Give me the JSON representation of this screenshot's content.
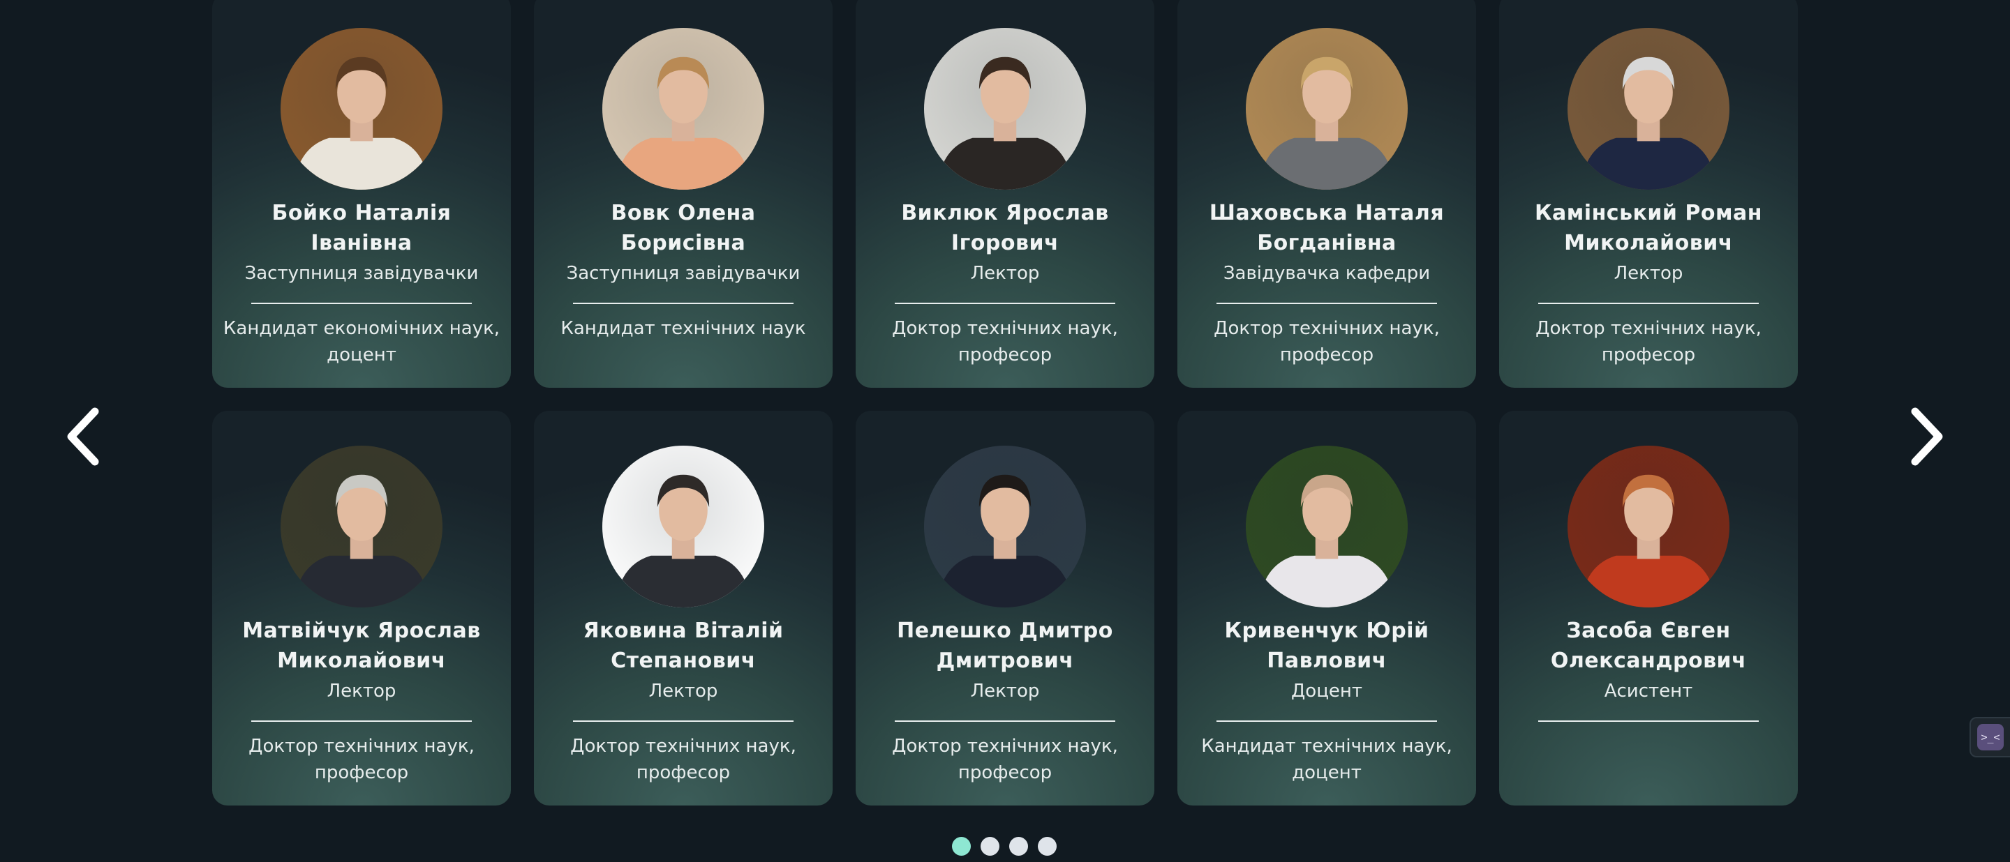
{
  "nav": {
    "prev_icon": "chevron-left-icon",
    "next_icon": "chevron-right-icon"
  },
  "staff": [
    {
      "name": "Бойко Наталія Іванівна",
      "role": "Заступниця завідувачки",
      "degree": "Кандидат економічних наук, доцент",
      "photo_colors": [
        "#8a5a2e",
        "#e9e4da",
        "#5b3b22"
      ]
    },
    {
      "name": "Вовк Олена Борисівна",
      "role": "Заступниця завідувачки",
      "degree": "Кандидат технічних наук",
      "photo_colors": [
        "#d9c9b4",
        "#e8a67f",
        "#b98a55"
      ]
    },
    {
      "name": "Виклюк Ярослав Ігорович",
      "role": "Лектор",
      "degree": "Доктор технічних наук, професор",
      "photo_colors": [
        "#d8d8d4",
        "#2a2624",
        "#3a2a20"
      ]
    },
    {
      "name": "Шаховська Наталя Богданівна",
      "role": "Завідувачка кафедри",
      "degree": "Доктор технічних наук, професор",
      "photo_colors": [
        "#b28a55",
        "#6b6e72",
        "#c9a56a"
      ]
    },
    {
      "name": "Камінський Роман Миколайович",
      "role": "Лектор",
      "degree": "Доктор технічних наук, професор",
      "photo_colors": [
        "#7a5a3a",
        "#1e2742",
        "#d8d8d8"
      ]
    },
    {
      "name": "Матвійчук Ярослав Миколайович",
      "role": "Лектор",
      "degree": "Доктор технічних наук, професор",
      "photo_colors": [
        "#3a3a2a",
        "#262a33",
        "#c9c9c4"
      ]
    },
    {
      "name": "Яковина Віталій Степанович",
      "role": "Лектор",
      "degree": "Доктор технічних наук, професор",
      "photo_colors": [
        "#ffffff",
        "#2a2d33",
        "#2e2a28"
      ]
    },
    {
      "name": "Пелешко Дмитро Дмитрович",
      "role": "Лектор",
      "degree": "Доктор технічних наук, професор",
      "photo_colors": [
        "#2d3a46",
        "#1c2230",
        "#1e1a18"
      ]
    },
    {
      "name": "Кривенчук Юрій Павлович",
      "role": "Доцент",
      "degree": "Кандидат технічних наук, доцент",
      "photo_colors": [
        "#2e4a22",
        "#e8e6ea",
        "#c9a68a"
      ]
    },
    {
      "name": "Засоба Євген Олександрович",
      "role": "Асистент",
      "degree": "",
      "photo_colors": [
        "#7a2a18",
        "#c03a1e",
        "#c2703e"
      ]
    }
  ],
  "pagination": {
    "pages": 4,
    "active": 1
  },
  "widget": {
    "icon": "chat-widget-icon",
    "glyph": ">_<"
  }
}
